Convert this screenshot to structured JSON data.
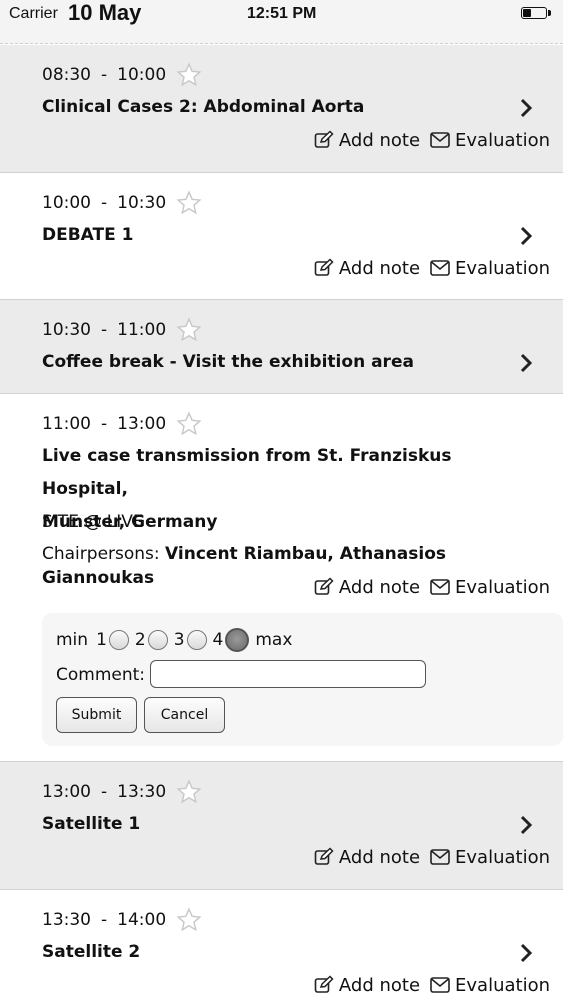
{
  "status_bar": {
    "carrier": "Carrier",
    "overlay_date": "10 May",
    "time": "12:51 PM",
    "battery_level": 0.4
  },
  "labels": {
    "add_note": "Add note",
    "evaluation": "Evaluation",
    "time_separator": "-"
  },
  "sessions": [
    {
      "start": "08:30",
      "end": "10:00",
      "title": "Clinical Cases 2: Abdominal Aorta"
    },
    {
      "start": "10:00",
      "end": "10:30",
      "title": "DEBATE 1"
    },
    {
      "start": "10:30",
      "end": "11:00",
      "title": "Coffee break - Visit the exhibition area"
    },
    {
      "start": "11:00",
      "end": "13:00",
      "title_line1": "Live case transmission from St. Franziskus Hospital,",
      "title_line2": "Munster, Germany",
      "subtitle": "SITE @ LIVE",
      "chair_label": "Chairpersons:",
      "chair_names": "Vincent Riambau, Athanasios Giannoukas"
    },
    {
      "start": "13:00",
      "end": "13:30",
      "title": "Satellite 1"
    },
    {
      "start": "13:30",
      "end": "14:00",
      "title": "Satellite 2"
    }
  ],
  "evaluation_form": {
    "min_label": "min",
    "max_label": "max",
    "options": [
      "1",
      "2",
      "3",
      "4"
    ],
    "selected": "4",
    "comment_label": "Comment:",
    "comment_value": "",
    "submit_label": "Submit",
    "cancel_label": "Cancel"
  }
}
